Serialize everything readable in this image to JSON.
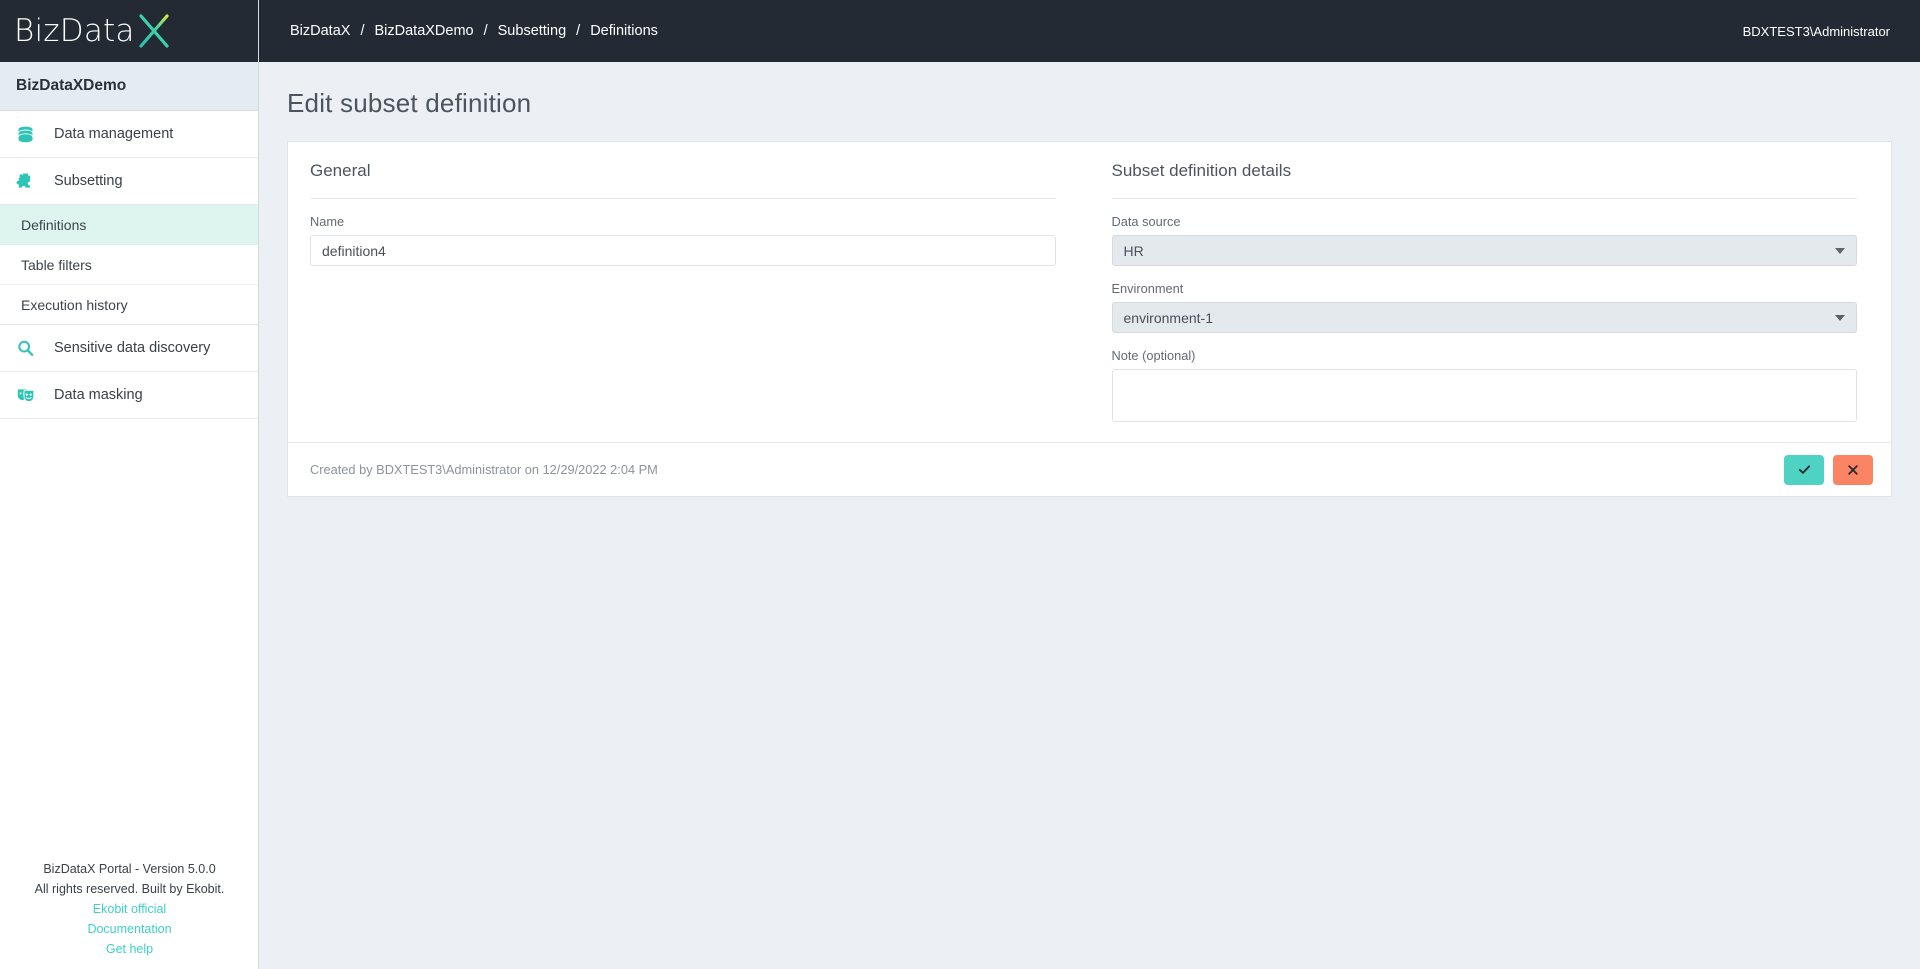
{
  "brand": {
    "logo_text": "BizData",
    "logo_mark": "X",
    "tenant": "BizDataXDemo",
    "accent_color": "#3fd0c9",
    "topbar_color": "#242a33",
    "confirm_color": "#4ed2c4",
    "cancel_color": "#fb8465",
    "active_item_color": "#ddf4ef"
  },
  "topbar": {
    "breadcrumbs": [
      {
        "label": "BizDataX"
      },
      {
        "label": "BizDataXDemo"
      },
      {
        "label": "Subsetting"
      },
      {
        "label": "Definitions"
      }
    ],
    "separator": "/",
    "user": "BDXTEST3\\Administrator"
  },
  "sidebar": {
    "items": [
      {
        "label": "Data management",
        "icon": "database-icon"
      },
      {
        "label": "Subsetting",
        "icon": "puzzle-piece-icon"
      }
    ],
    "sub_items": [
      {
        "label": "Definitions",
        "active": true
      },
      {
        "label": "Table filters",
        "active": false
      },
      {
        "label": "Execution history",
        "active": false
      }
    ],
    "items_bottom": [
      {
        "label": "Sensitive data discovery",
        "icon": "magnifier-icon"
      },
      {
        "label": "Data masking",
        "icon": "theatre-masks-icon"
      }
    ],
    "footer": {
      "version": "BizDataX Portal - Version 5.0.0",
      "rights": "All rights reserved. Built by Ekobit.",
      "links": [
        {
          "label": "Ekobit official"
        },
        {
          "label": "Documentation"
        },
        {
          "label": "Get help"
        }
      ]
    }
  },
  "page": {
    "title": "Edit subset definition",
    "general": {
      "heading": "General",
      "name_label": "Name",
      "name_value": "definition4",
      "name_placeholder": ""
    },
    "details": {
      "heading": "Subset definition details",
      "data_source_label": "Data source",
      "data_source_value": "HR",
      "environment_label": "Environment",
      "environment_value": "environment-1",
      "note_label": "Note (optional)",
      "note_value": "",
      "note_placeholder": ""
    },
    "footer": {
      "created_by": "Created by BDXTEST3\\Administrator on 12/29/2022 2:04 PM",
      "confirm_label": "✓",
      "cancel_label": "✕"
    }
  }
}
